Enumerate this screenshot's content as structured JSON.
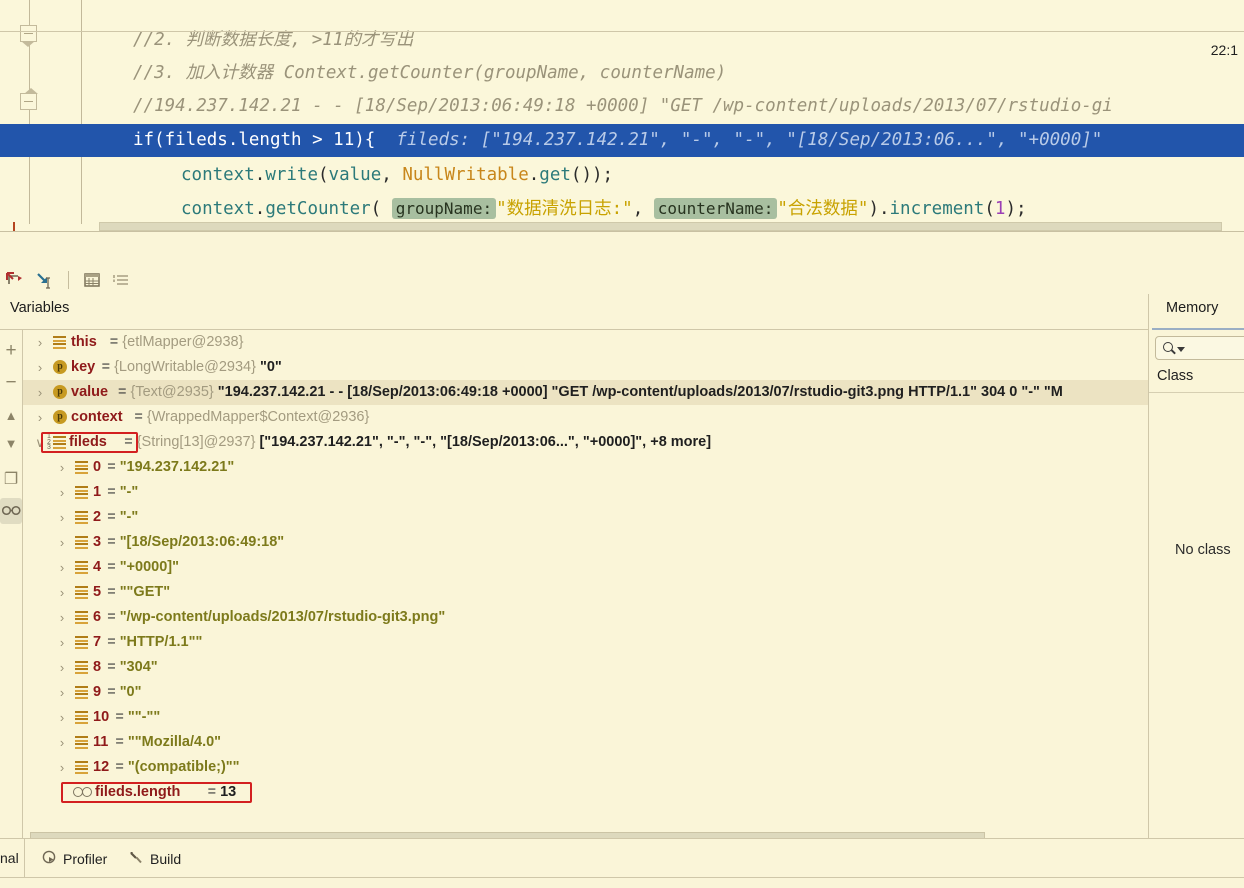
{
  "editor": {
    "lines": [
      {
        "type": "comment",
        "text": "//2. 判断数据长度, >11的才写出"
      },
      {
        "type": "comment",
        "text": "//3. 加入计数器 Context.getCounter(groupName, counterName)"
      },
      {
        "type": "comment",
        "text": "//194.237.142.21 - - [18/Sep/2013:06:49:18 +0000] \"GET /wp-content/uploads/2013/07/rstudio-gi"
      }
    ],
    "highlighted_line": {
      "code": "if(fileds.length > 11){",
      "inline_hint": "fileds: [\"194.237.142.21\", \"-\", \"-\", \"[18/Sep/2013:06...\", \"+0000]\""
    },
    "line_write": {
      "obj": "context",
      "dot1": ".",
      "method": "write",
      "open": "(",
      "arg1": "value",
      "comma": ", ",
      "arg2": "NullWritable",
      "dot2": ".",
      "arg2method": "get",
      "close": "());"
    },
    "line_counter": {
      "obj": "context",
      "dot1": ".",
      "method": "getCounter",
      "open": "( ",
      "hint1": "groupName:",
      "str1": "\"数据清洗日志:\"",
      "comma": ", ",
      "hint2": "counterName:",
      "str2": "\"合法数据\"",
      "mid": ").",
      "method2": "increment",
      "num": "1",
      "close": ");"
    }
  },
  "debug_toolbar": {
    "buttons": [
      {
        "name": "step-out-icon",
        "tooltip": "Step Out"
      },
      {
        "name": "run-to-cursor-icon",
        "tooltip": "Run to Cursor"
      },
      {
        "name": "evaluate-expression-icon",
        "tooltip": "Evaluate Expression"
      },
      {
        "name": "settings-icon",
        "tooltip": "Layout Settings"
      }
    ]
  },
  "panels": {
    "variables_tab": "Variables",
    "memory_tab": "Memory"
  },
  "left_toolbar": {
    "buttons": [
      {
        "name": "add-watch-button",
        "glyph": "+"
      },
      {
        "name": "remove-watch-button",
        "glyph": "−"
      },
      {
        "name": "move-up-button",
        "glyph": "▲"
      },
      {
        "name": "move-down-button",
        "glyph": "▼"
      },
      {
        "name": "copy-button",
        "glyph": "❐"
      },
      {
        "name": "watches-toggle-button",
        "glyph": ""
      }
    ]
  },
  "variables": [
    {
      "indent": 0,
      "chev": "closed",
      "icon": "arr",
      "name": "this",
      "ref": "{etlMapper@2938}",
      "value": "",
      "highlight": false,
      "boxed": false
    },
    {
      "indent": 0,
      "chev": "closed",
      "icon": "param",
      "name": "key",
      "ref": "{LongWritable@2934}",
      "value": "\"0\"",
      "highlight": false,
      "boxed": false
    },
    {
      "indent": 0,
      "chev": "closed",
      "icon": "param",
      "name": "value",
      "ref": "{Text@2935}",
      "value": "\"194.237.142.21 - - [18/Sep/2013:06:49:18 +0000] \"GET /wp-content/uploads/2013/07/rstudio-git3.png HTTP/1.1\" 304 0 \"-\" \"M",
      "highlight": true,
      "boxed": false
    },
    {
      "indent": 0,
      "chev": "closed",
      "icon": "param",
      "name": "context",
      "ref": "{WrappedMapper$Context@2936}",
      "value": "",
      "highlight": false,
      "boxed": false
    },
    {
      "indent": 0,
      "chev": "open",
      "icon": "arrnum",
      "name": "fileds",
      "ref": "{String[13]@2937}",
      "value": "[\"194.237.142.21\", \"-\", \"-\", \"[18/Sep/2013:06...\", \"+0000]\", +8 more]",
      "highlight": false,
      "boxed": true
    },
    {
      "indent": 1,
      "chev": "closed",
      "icon": "arr",
      "name": "0",
      "ref": "",
      "value": "\"194.237.142.21\"",
      "highlight": false,
      "boxed": false
    },
    {
      "indent": 1,
      "chev": "closed",
      "icon": "arr",
      "name": "1",
      "ref": "",
      "value": "\"-\"",
      "highlight": false,
      "boxed": false
    },
    {
      "indent": 1,
      "chev": "closed",
      "icon": "arr",
      "name": "2",
      "ref": "",
      "value": "\"-\"",
      "highlight": false,
      "boxed": false
    },
    {
      "indent": 1,
      "chev": "closed",
      "icon": "arr",
      "name": "3",
      "ref": "",
      "value": "\"[18/Sep/2013:06:49:18\"",
      "highlight": false,
      "boxed": false
    },
    {
      "indent": 1,
      "chev": "closed",
      "icon": "arr",
      "name": "4",
      "ref": "",
      "value": "\"+0000]\"",
      "highlight": false,
      "boxed": false
    },
    {
      "indent": 1,
      "chev": "closed",
      "icon": "arr",
      "name": "5",
      "ref": "",
      "value": "\"\"GET\"",
      "highlight": false,
      "boxed": false
    },
    {
      "indent": 1,
      "chev": "closed",
      "icon": "arr",
      "name": "6",
      "ref": "",
      "value": "\"/wp-content/uploads/2013/07/rstudio-git3.png\"",
      "highlight": false,
      "boxed": false
    },
    {
      "indent": 1,
      "chev": "closed",
      "icon": "arr",
      "name": "7",
      "ref": "",
      "value": "\"HTTP/1.1\"\"",
      "highlight": false,
      "boxed": false
    },
    {
      "indent": 1,
      "chev": "closed",
      "icon": "arr",
      "name": "8",
      "ref": "",
      "value": "\"304\"",
      "highlight": false,
      "boxed": false
    },
    {
      "indent": 1,
      "chev": "closed",
      "icon": "arr",
      "name": "9",
      "ref": "",
      "value": "\"0\"",
      "highlight": false,
      "boxed": false
    },
    {
      "indent": 1,
      "chev": "closed",
      "icon": "arr",
      "name": "10",
      "ref": "",
      "value": "\"\"-\"\"",
      "highlight": false,
      "boxed": false
    },
    {
      "indent": 1,
      "chev": "closed",
      "icon": "arr",
      "name": "11",
      "ref": "",
      "value": "\"\"Mozilla/4.0\"",
      "highlight": false,
      "boxed": false
    },
    {
      "indent": 1,
      "chev": "closed",
      "icon": "arr",
      "name": "12",
      "ref": "",
      "value": "\"(compatible;)\"\"",
      "highlight": false,
      "boxed": false
    },
    {
      "indent": 1,
      "chev": "none",
      "icon": "watch",
      "name": "fileds.length",
      "ref": "",
      "value": "13",
      "highlight": false,
      "boxed": true
    }
  ],
  "memory": {
    "search_placeholder": "",
    "column_header": "Class",
    "empty_message": "No class"
  },
  "statusbar": {
    "items": [
      {
        "label": "nal",
        "icon": ""
      },
      {
        "label": "Profiler",
        "icon": "profiler-icon"
      },
      {
        "label": "Build",
        "icon": "hammer-icon"
      }
    ],
    "time": "22:1"
  },
  "colors": {
    "background": "#faf5d8",
    "highlight_line": "#2255ab",
    "value_row_highlight": "#ece3c2",
    "red_box": "#d32020",
    "breakpoint": "#9b1b22",
    "param_hint_bg": "#a8bfa0"
  }
}
